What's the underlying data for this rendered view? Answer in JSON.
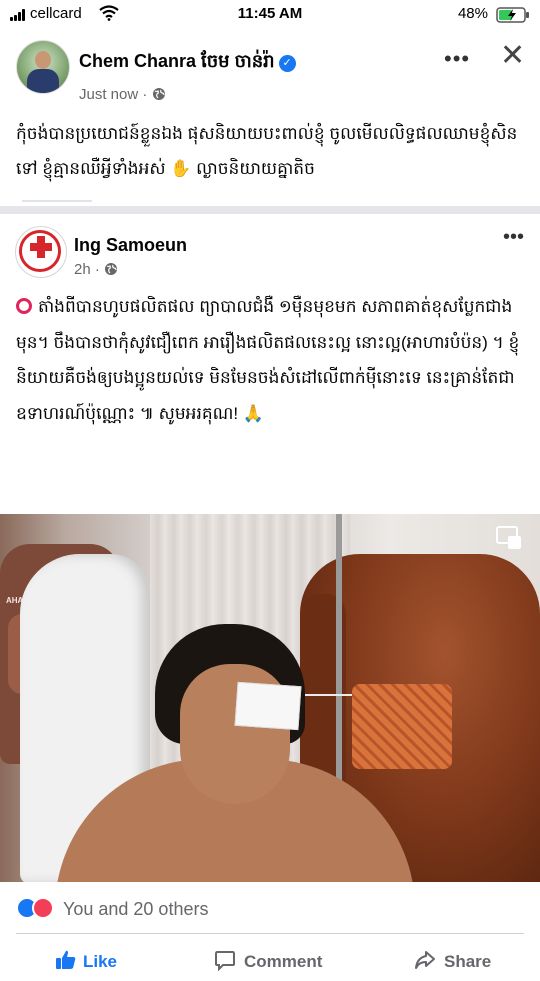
{
  "status_bar": {
    "carrier": "cellcard",
    "time": "11:45 AM",
    "battery": "48%"
  },
  "post1": {
    "author": "Chem Chanra ចែម ចាន់រ៉ា",
    "timestamp": "Just now · ",
    "text": "កុំចង់បានប្រយោជន៍ខ្លួនឯង ផុសនិយាយបះពាល់ខ្ញុំ ចូលមើលលិទ្ធផលឈាមខ្ញុំសិនទៅ ខ្ញុំគ្មានឈឺអ្វីទាំងអស់ ✋ ល្ងាចនិយាយគ្នាតិច",
    "more_label": "•••",
    "close_label": "✕"
  },
  "post2": {
    "author": "Ing Samoeun",
    "timestamp": "2h · ",
    "text": "តាំងពីបានហូបផលិតផល ព្យាបាលជំងឺ ១ម៉ឺនមុខមក  សភាពគាត់ខុសប្លែកជាងមុន។ ចឹងបានថាកុំសូវជឿពេក អារឿងផលិតផលនេះល្អ នោះល្អ(អាហារបំប៉ន) ។ ខ្ញុំនិយាយគឺចង់ឲ្យបងប្អូនយល់ទេ មិនមែនចង់សំដៅលើពាក់ម៉ីនោះទេ នេះគ្រាន់តែជាឧទាហរណ៍ប៉ុណ្ណោះ ៕ សូមអរគុណ! 🙏",
    "more_label": "•••",
    "photo_brand": "AHAKA",
    "reactions": "You and 20 others",
    "actions": {
      "like": "Like",
      "comment": "Comment",
      "share": "Share"
    }
  },
  "icons": [
    "signal-icon",
    "wifi-icon",
    "battery-icon",
    "verified-icon",
    "globe-icon",
    "reaction-like-icon",
    "reaction-love-icon",
    "thumbs-up-icon",
    "comment-icon",
    "share-icon"
  ]
}
